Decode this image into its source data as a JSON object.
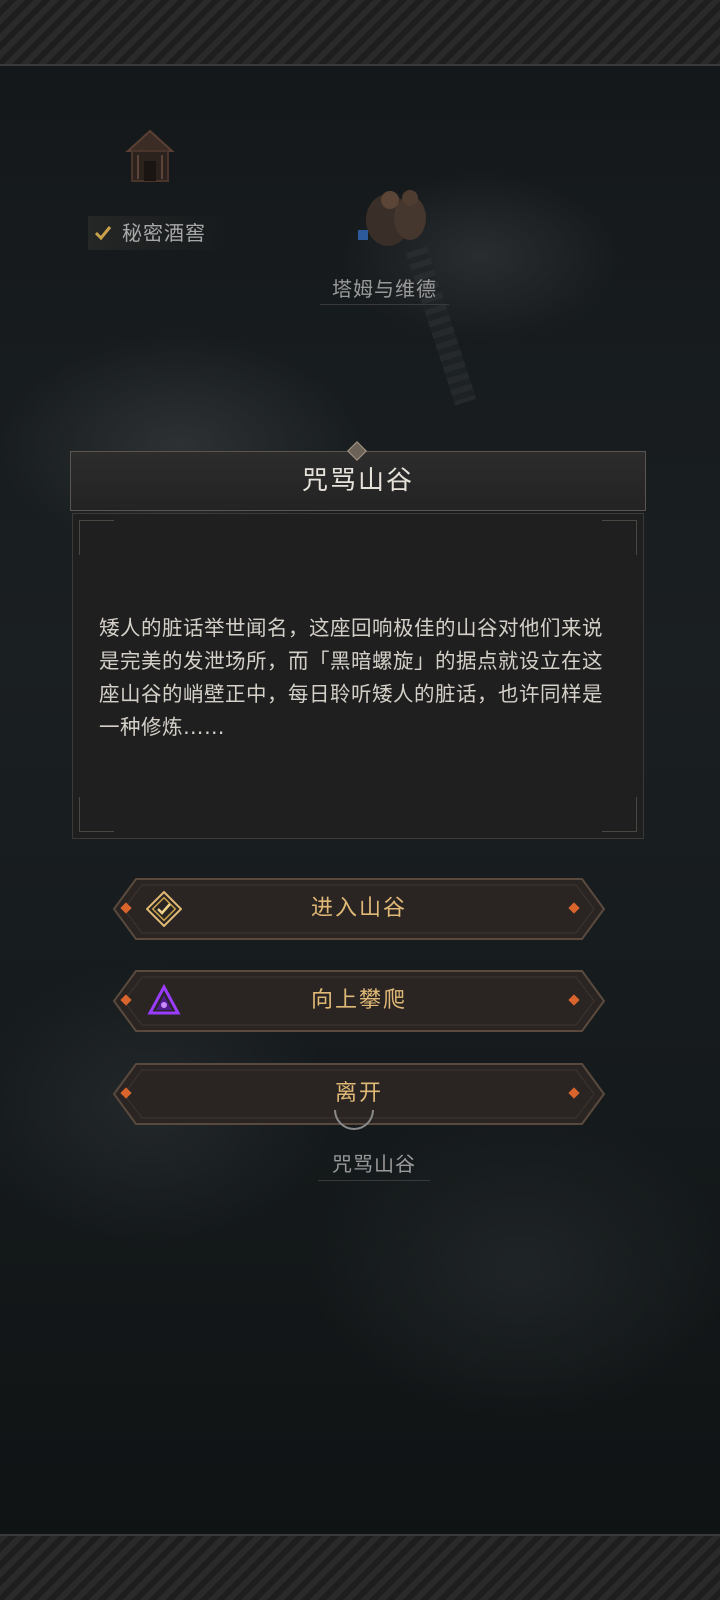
{
  "map": {
    "labels": {
      "secret_cellar": "秘密酒窖",
      "tam_and_wade": "塔姆与维德",
      "cursed_valley": "咒骂山谷"
    }
  },
  "dialog": {
    "title": "咒骂山谷",
    "description": "矮人的脏话举世闻名，这座回响极佳的山谷对他们来说是完美的发泄场所，而「黑暗螺旋」的据点就设立在这座山谷的峭壁正中，每日聆听矮人的脏话，也许同样是一种修炼……"
  },
  "options": [
    {
      "label": "进入山谷",
      "icon": "gold-diamond-check-icon"
    },
    {
      "label": "向上攀爬",
      "icon": "purple-triangle-swirl-icon"
    },
    {
      "label": "离开",
      "icon": ""
    }
  ],
  "colors": {
    "accent_gold": "#e0b976",
    "ember": "#d9642c",
    "purple": "#9a3cff"
  }
}
